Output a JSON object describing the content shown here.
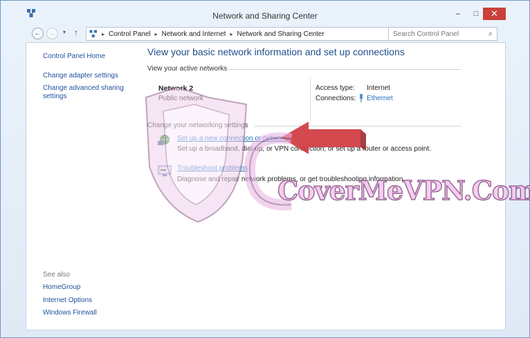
{
  "window": {
    "title": "Network and Sharing Center",
    "minimize": "–",
    "maximize": "□",
    "close": "✕"
  },
  "nav": {
    "back": "←",
    "forward": "→",
    "recent": "▾",
    "up": "↑"
  },
  "address": {
    "crumbs": [
      "Control Panel",
      "Network and Internet",
      "Network and Sharing Center"
    ],
    "separator": "▸",
    "dropdown": "⌄",
    "refresh": "↻"
  },
  "search": {
    "placeholder": "Search Control Panel",
    "icon": "⌕"
  },
  "left_pane": {
    "home": "Control Panel Home",
    "adapter": "Change adapter settings",
    "advanced_line1": "Change advanced sharing",
    "advanced_line2": "settings",
    "see_also": "See also",
    "homegroup": "HomeGroup",
    "internet_options": "Internet Options",
    "firewall": "Windows Firewall"
  },
  "main": {
    "title": "View your basic network information and set up connections",
    "active_networks_label": "View your active networks",
    "network_name": "Network  2",
    "network_type": "Public network",
    "access_type_label": "Access type:",
    "access_type_value": "Internet",
    "connections_label": "Connections:",
    "connections_value": "Ethernet",
    "change_settings_label": "Change your networking settings",
    "task1_link": "Set up a new connection or network",
    "task1_desc": "Set up a broadband, dial-up, or VPN connection; or set up a router or access point.",
    "task2_link": "Troubleshoot problems",
    "task2_desc": "Diagnose and repair network problems, or get troubleshooting information."
  },
  "watermark": {
    "text": "CoverMeVPN.Com"
  },
  "colors": {
    "link": "#1f6fbf",
    "title_blue": "#1e4e8c",
    "close_red": "#c9413a",
    "arrow_red": "#d0393f",
    "watermark_pink": "#f3c6ef"
  }
}
